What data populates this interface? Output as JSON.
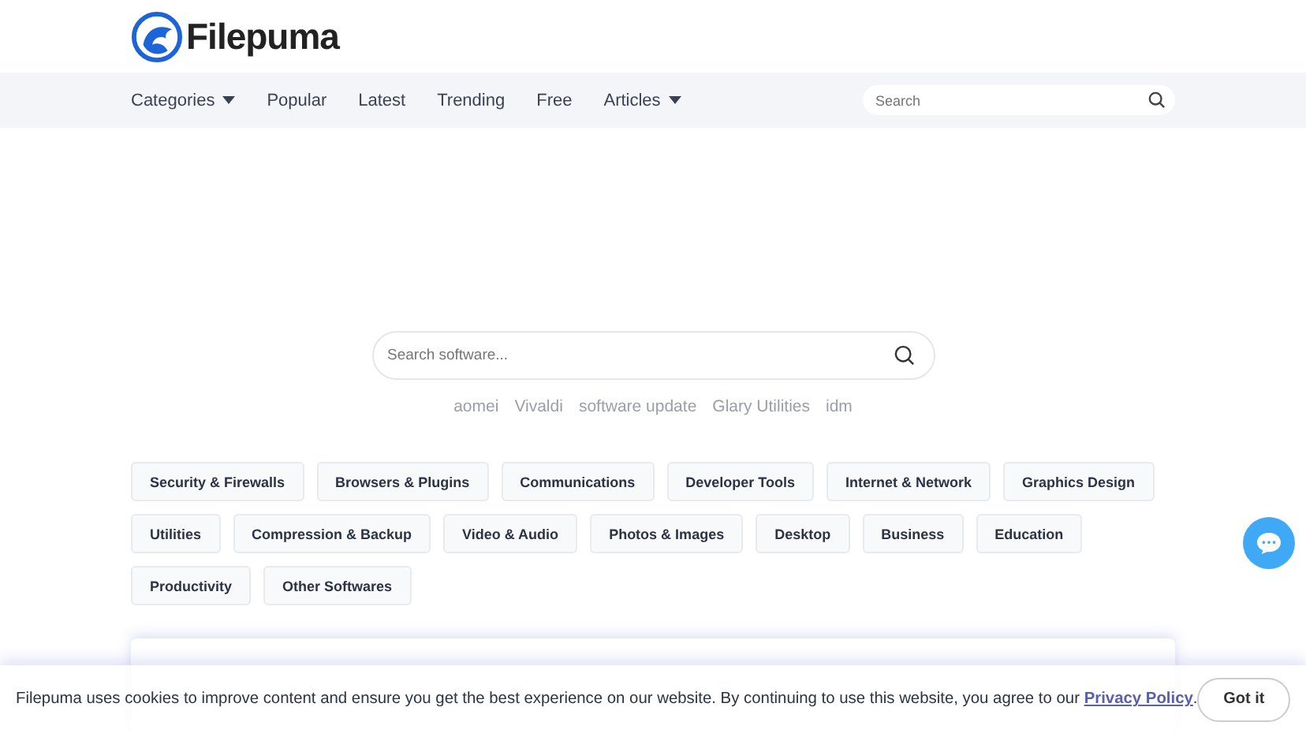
{
  "logo": {
    "text": "Filepuma"
  },
  "nav": [
    {
      "label": "Categories",
      "dropdown": true
    },
    {
      "label": "Popular",
      "dropdown": false
    },
    {
      "label": "Latest",
      "dropdown": false
    },
    {
      "label": "Trending",
      "dropdown": false
    },
    {
      "label": "Free",
      "dropdown": false
    },
    {
      "label": "Articles",
      "dropdown": true
    }
  ],
  "nav_search": {
    "placeholder": "Search"
  },
  "hero_search": {
    "placeholder": "Search software..."
  },
  "popular_searches": [
    "aomei",
    "Vivaldi",
    "software update",
    "Glary Utilities",
    "idm"
  ],
  "categories": [
    "Security & Firewalls",
    "Browsers & Plugins",
    "Communications",
    "Developer Tools",
    "Internet & Network",
    "Graphics Design",
    "Utilities",
    "Compression & Backup",
    "Video & Audio",
    "Photos & Images",
    "Desktop",
    "Business",
    "Education",
    "Productivity",
    "Other Softwares"
  ],
  "cookie_banner": {
    "text": "Filepuma uses cookies to improve content and ensure you get the best experience on our website. By continuing to use this website, you agree to our ",
    "link": "Privacy Policy",
    "after": ".",
    "button": "Got it"
  }
}
